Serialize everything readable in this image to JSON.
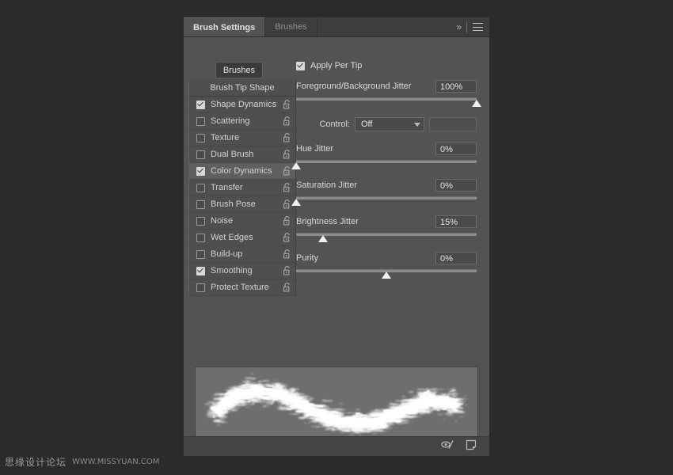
{
  "panel": {
    "tabs": [
      {
        "label": "Brush Settings",
        "active": true
      },
      {
        "label": "Brushes",
        "active": false
      }
    ],
    "header_icons": {
      "collapse": "»",
      "menu": "panel-menu-icon"
    },
    "brushes_button": "Brushes"
  },
  "options": {
    "header": "Brush Tip Shape",
    "items": [
      {
        "label": "Shape Dynamics",
        "checked": true,
        "selected": false,
        "locked": false
      },
      {
        "label": "Scattering",
        "checked": false,
        "selected": false,
        "locked": false
      },
      {
        "label": "Texture",
        "checked": false,
        "selected": false,
        "locked": false
      },
      {
        "label": "Dual Brush",
        "checked": false,
        "selected": false,
        "locked": false
      },
      {
        "label": "Color Dynamics",
        "checked": true,
        "selected": true,
        "locked": false
      },
      {
        "label": "Transfer",
        "checked": false,
        "selected": false,
        "locked": false
      },
      {
        "label": "Brush Pose",
        "checked": false,
        "selected": false,
        "locked": false
      },
      {
        "label": "Noise",
        "checked": false,
        "selected": false,
        "locked": false
      },
      {
        "label": "Wet Edges",
        "checked": false,
        "selected": false,
        "locked": false
      },
      {
        "label": "Build-up",
        "checked": false,
        "selected": false,
        "locked": false
      },
      {
        "label": "Smoothing",
        "checked": true,
        "selected": false,
        "locked": false
      },
      {
        "label": "Protect Texture",
        "checked": false,
        "selected": false,
        "locked": false
      }
    ]
  },
  "color_dynamics": {
    "apply_per_tip": {
      "label": "Apply Per Tip",
      "checked": true
    },
    "fg_bg_jitter": {
      "label": "Foreground/Background Jitter",
      "value": "100%",
      "percent": 100
    },
    "control": {
      "label": "Control:",
      "value": "Off",
      "extra_value": ""
    },
    "hue_jitter": {
      "label": "Hue Jitter",
      "value": "0%",
      "percent": 0
    },
    "saturation_jitter": {
      "label": "Saturation Jitter",
      "value": "0%",
      "percent": 0
    },
    "brightness_jitter": {
      "label": "Brightness Jitter",
      "value": "15%",
      "percent": 15
    },
    "purity": {
      "label": "Purity",
      "value": "0%",
      "percent": 50
    }
  },
  "preview": {
    "name": "brush-stroke-preview"
  },
  "footer": {
    "icons": [
      {
        "name": "toggle-brush-settings-icon"
      },
      {
        "name": "create-new-brush-icon"
      }
    ]
  },
  "watermark": {
    "cn": "思缘设计论坛",
    "en": "WWW.MISSYUAN.COM"
  },
  "colors": {
    "panel_bg": "#535353",
    "tabbar_bg": "#3d3d3d",
    "list_bg": "#4f4f4f",
    "selected_row": "#5f6060",
    "text": "#d7d7d7",
    "field_bg": "#4a4a4a",
    "track": "#8d8d8d",
    "thumb": "#f0f0f0",
    "preview_bg": "#6e6e6e",
    "app_bg": "#2b2b2b"
  }
}
